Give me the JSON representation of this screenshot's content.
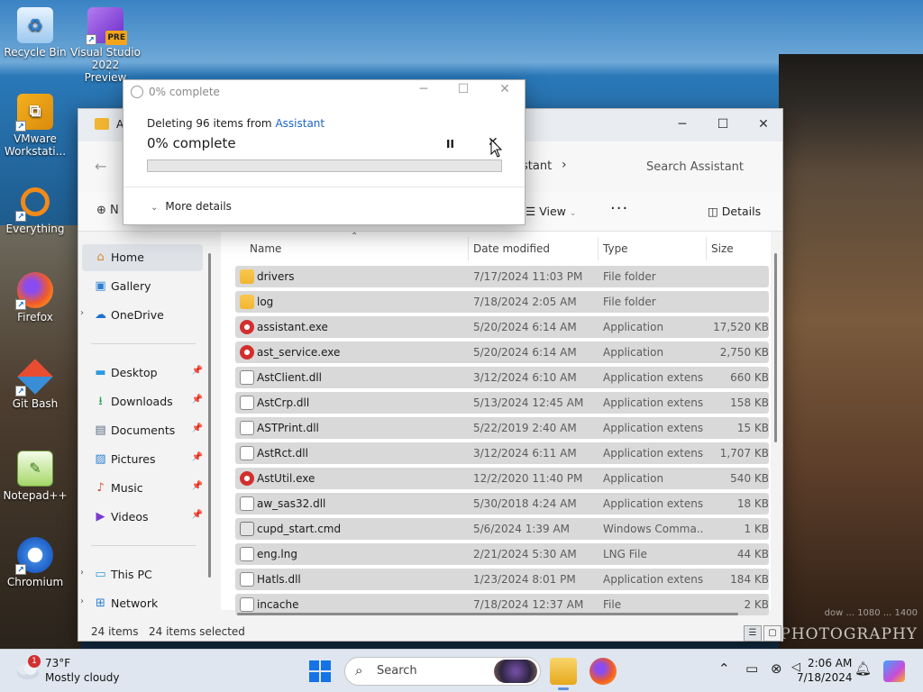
{
  "desktop": {
    "icons": [
      {
        "label": "Recycle Bin"
      },
      {
        "label": "Visual Studio 2022 Preview",
        "badge": "PRE"
      },
      {
        "label": "VMware Workstati..."
      },
      {
        "label": "Everything"
      },
      {
        "label": "Firefox"
      },
      {
        "label": "Git Bash"
      },
      {
        "label": "Notepad++"
      },
      {
        "label": "Chromium"
      }
    ],
    "watermark": "PHOTOGRAPHY",
    "watermark_sub": "dow ... 1080 ... 1400"
  },
  "explorer": {
    "tab_initial": "A",
    "breadcrumb": "stant",
    "search_placeholder": "Search Assistant",
    "new_initial": "N",
    "view_label": "View",
    "more_label": "···",
    "details_label": "Details",
    "nav": {
      "home": "Home",
      "gallery": "Gallery",
      "onedrive": "OneDrive",
      "desktop": "Desktop",
      "downloads": "Downloads",
      "documents": "Documents",
      "pictures": "Pictures",
      "music": "Music",
      "videos": "Videos",
      "thispc": "This PC",
      "network": "Network"
    },
    "columns": {
      "name": "Name",
      "date": "Date modified",
      "type": "Type",
      "size": "Size"
    },
    "files": [
      {
        "name": "drivers",
        "date": "7/17/2024 11:03 PM",
        "type": "File folder",
        "size": "",
        "icon": "folder"
      },
      {
        "name": "log",
        "date": "7/18/2024 2:05 AM",
        "type": "File folder",
        "size": "",
        "icon": "folder"
      },
      {
        "name": "assistant.exe",
        "date": "5/20/2024 6:14 AM",
        "type": "Application",
        "size": "17,520 KB",
        "icon": "exe"
      },
      {
        "name": "ast_service.exe",
        "date": "5/20/2024 6:14 AM",
        "type": "Application",
        "size": "2,750 KB",
        "icon": "exe"
      },
      {
        "name": "AstClient.dll",
        "date": "3/12/2024 6:10 AM",
        "type": "Application extens...",
        "size": "660 KB",
        "icon": "dll"
      },
      {
        "name": "AstCrp.dll",
        "date": "5/13/2024 12:45 AM",
        "type": "Application extens...",
        "size": "158 KB",
        "icon": "dll"
      },
      {
        "name": "ASTPrint.dll",
        "date": "5/22/2019 2:40 AM",
        "type": "Application extens...",
        "size": "15 KB",
        "icon": "dll"
      },
      {
        "name": "AstRct.dll",
        "date": "3/12/2024 6:11 AM",
        "type": "Application extens...",
        "size": "1,707 KB",
        "icon": "dll"
      },
      {
        "name": "AstUtil.exe",
        "date": "12/2/2020 11:40 PM",
        "type": "Application",
        "size": "540 KB",
        "icon": "exe"
      },
      {
        "name": "aw_sas32.dll",
        "date": "5/30/2018 4:24 AM",
        "type": "Application extens...",
        "size": "18 KB",
        "icon": "dll"
      },
      {
        "name": "cupd_start.cmd",
        "date": "5/6/2024 1:39 AM",
        "type": "Windows Comma...",
        "size": "1 KB",
        "icon": "cmd"
      },
      {
        "name": "eng.lng",
        "date": "2/21/2024 5:30 AM",
        "type": "LNG File",
        "size": "44 KB",
        "icon": "dll"
      },
      {
        "name": "Hatls.dll",
        "date": "1/23/2024 8:01 PM",
        "type": "Application extens...",
        "size": "184 KB",
        "icon": "dll"
      },
      {
        "name": "incache",
        "date": "7/18/2024 12:37 AM",
        "type": "File",
        "size": "2 KB",
        "icon": "dll"
      }
    ],
    "status": {
      "count": "24 items",
      "selected": "24 items selected"
    }
  },
  "dialog": {
    "title": "0% complete",
    "desc_prefix": "Deleting 96 items from",
    "desc_link": "Assistant",
    "percent_text": "0% complete",
    "progress": 0,
    "pause_glyph": "II",
    "cancel_glyph": "✕",
    "more_details": "More details"
  },
  "taskbar": {
    "temp": "73°F",
    "condition": "Mostly cloudy",
    "badge": "1",
    "search_label": "Search",
    "time": "2:06 AM",
    "date": "7/18/2024"
  }
}
